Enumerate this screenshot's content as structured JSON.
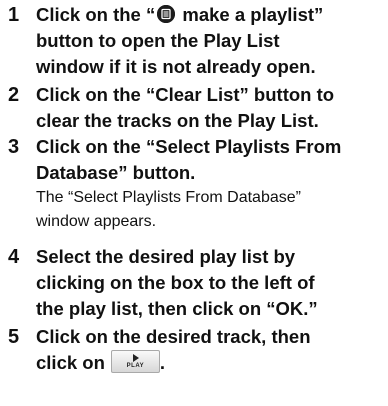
{
  "steps": [
    {
      "number": "1",
      "line1_before_icon": "Click on the “",
      "line1_after_icon": " make a playlist”",
      "line2": "button to open the Play List",
      "line3": "window if it is not already open."
    },
    {
      "number": "2",
      "line1": "Click on the “Clear List” button to",
      "line2": "clear the tracks on the Play List."
    },
    {
      "number": "3",
      "line1": "Click on the “Select Playlists From",
      "line2": "Database” button.",
      "note_line1": "The “Select Playlists From Database”",
      "note_line2": "window appears."
    },
    {
      "number": "4",
      "line1": "Select the desired play list by",
      "line2": "clicking on the box to the left of",
      "line3": "the play list, then click on “OK.”"
    },
    {
      "number": "5",
      "line1": "Click on the desired track, then",
      "line2_before_button": "click on",
      "line2_after_button": "."
    }
  ],
  "icons": {
    "playlist_icon": "playlist-icon",
    "play_button_icon": "play-button-icon"
  },
  "play_button": {
    "label": "PLAY"
  }
}
